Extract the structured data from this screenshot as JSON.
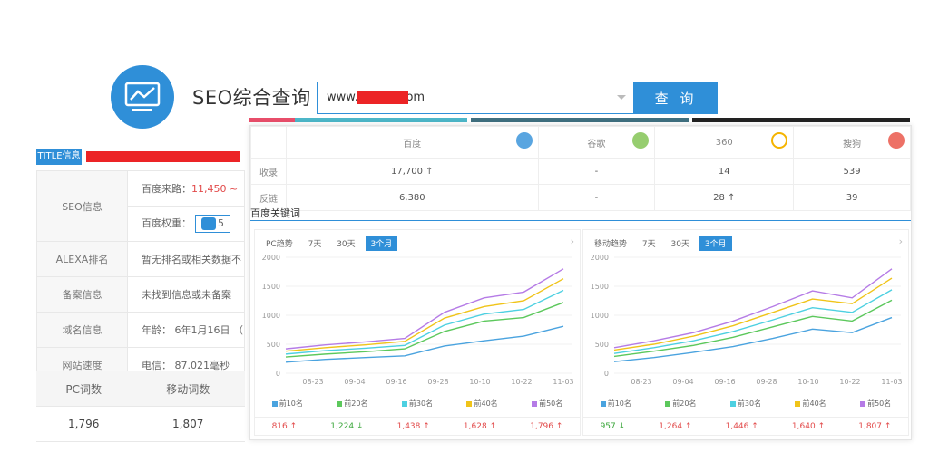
{
  "header": {
    "title": "SEO综合查询",
    "search_value": "www.          .com",
    "query_button": "查 询"
  },
  "left": {
    "title_tag": "TITLE信息",
    "rows": [
      {
        "key": "SEO信息",
        "lines": [
          {
            "label": "百度来路：",
            "value": "11,450 ~"
          },
          {
            "label": "百度权重：",
            "value": "5"
          }
        ]
      },
      {
        "key": "ALEXA排名",
        "value": "暂无排名或相关数据不"
      },
      {
        "key": "备案信息",
        "value": "未找到信息或未备案"
      },
      {
        "key": "域名信息",
        "value": "年龄： 6年1月16日 （"
      },
      {
        "key": "网站速度",
        "value": "电信： 87.021毫秒"
      }
    ],
    "bottom": {
      "headers": [
        "PC词数",
        "移动词数"
      ],
      "values": [
        "1,796",
        "1,807"
      ]
    }
  },
  "engines": {
    "headers": [
      "百度",
      "谷歌",
      "360",
      "搜狗"
    ],
    "rows": [
      {
        "label": "收录",
        "values": [
          "17,700 ↑",
          "-",
          "14",
          "539"
        ]
      },
      {
        "label": "反链",
        "values": [
          "6,380",
          "-",
          "28 ↑",
          "39"
        ]
      }
    ],
    "colors": [
      "#2f8fd8",
      "#7cc04b",
      "#f5b400",
      "#e84e40"
    ]
  },
  "keywords": {
    "section_title": "百度关键词",
    "charts": [
      {
        "tabs": [
          "PC趋势",
          "7天",
          "30天",
          "3个月"
        ],
        "active_tab": "3个月",
        "legend": [
          "前10名",
          "前20名",
          "前30名",
          "前40名",
          "前50名"
        ],
        "values": [
          {
            "text": "816",
            "dir": "↑"
          },
          {
            "text": "1,224",
            "dir": "↓"
          },
          {
            "text": "1,438",
            "dir": "↑"
          },
          {
            "text": "1,628",
            "dir": "↑"
          },
          {
            "text": "1,796",
            "dir": "↑"
          }
        ]
      },
      {
        "tabs": [
          "移动趋势",
          "7天",
          "30天",
          "3个月"
        ],
        "active_tab": "3个月",
        "legend": [
          "前10名",
          "前20名",
          "前30名",
          "前40名",
          "前50名"
        ],
        "values": [
          {
            "text": "957",
            "dir": "↓"
          },
          {
            "text": "1,264",
            "dir": "↑"
          },
          {
            "text": "1,446",
            "dir": "↑"
          },
          {
            "text": "1,640",
            "dir": "↑"
          },
          {
            "text": "1,807",
            "dir": "↑"
          }
        ]
      }
    ]
  },
  "chart_data": [
    {
      "type": "line",
      "title": "PC趋势",
      "x": [
        "08-23",
        "09-04",
        "09-16",
        "09-28",
        "10-10",
        "10-22",
        "11-03"
      ],
      "ylim": [
        0,
        2000
      ],
      "yticks": [
        0,
        500,
        1000,
        1500,
        2000
      ],
      "series": [
        {
          "name": "前10名",
          "color": "#4aa3df",
          "values": [
            190,
            240,
            270,
            300,
            470,
            560,
            640,
            810
          ]
        },
        {
          "name": "前20名",
          "color": "#5cc85c",
          "values": [
            280,
            330,
            370,
            420,
            720,
            900,
            960,
            1220
          ]
        },
        {
          "name": "前30名",
          "color": "#4dd0e1",
          "values": [
            330,
            390,
            430,
            480,
            830,
            1020,
            1100,
            1430
          ]
        },
        {
          "name": "前40名",
          "color": "#f0c419",
          "values": [
            380,
            440,
            490,
            550,
            950,
            1150,
            1250,
            1630
          ]
        },
        {
          "name": "前50名",
          "color": "#b57be6",
          "values": [
            420,
            490,
            540,
            600,
            1050,
            1300,
            1400,
            1800
          ]
        }
      ]
    },
    {
      "type": "line",
      "title": "移动趋势",
      "x": [
        "08-23",
        "09-04",
        "09-16",
        "09-28",
        "10-10",
        "10-22",
        "11-03"
      ],
      "ylim": [
        0,
        2000
      ],
      "yticks": [
        0,
        500,
        1000,
        1500,
        2000
      ],
      "series": [
        {
          "name": "前10名",
          "color": "#4aa3df",
          "values": [
            200,
            270,
            360,
            460,
            600,
            760,
            700,
            960
          ]
        },
        {
          "name": "前20名",
          "color": "#5cc85c",
          "values": [
            290,
            380,
            480,
            620,
            800,
            980,
            900,
            1260
          ]
        },
        {
          "name": "前30名",
          "color": "#4dd0e1",
          "values": [
            340,
            440,
            560,
            720,
            920,
            1130,
            1050,
            1440
          ]
        },
        {
          "name": "前40名",
          "color": "#f0c419",
          "values": [
            400,
            500,
            640,
            820,
            1050,
            1280,
            1200,
            1640
          ]
        },
        {
          "name": "前50名",
          "color": "#b57be6",
          "values": [
            440,
            560,
            700,
            900,
            1150,
            1420,
            1300,
            1800
          ]
        }
      ]
    }
  ]
}
